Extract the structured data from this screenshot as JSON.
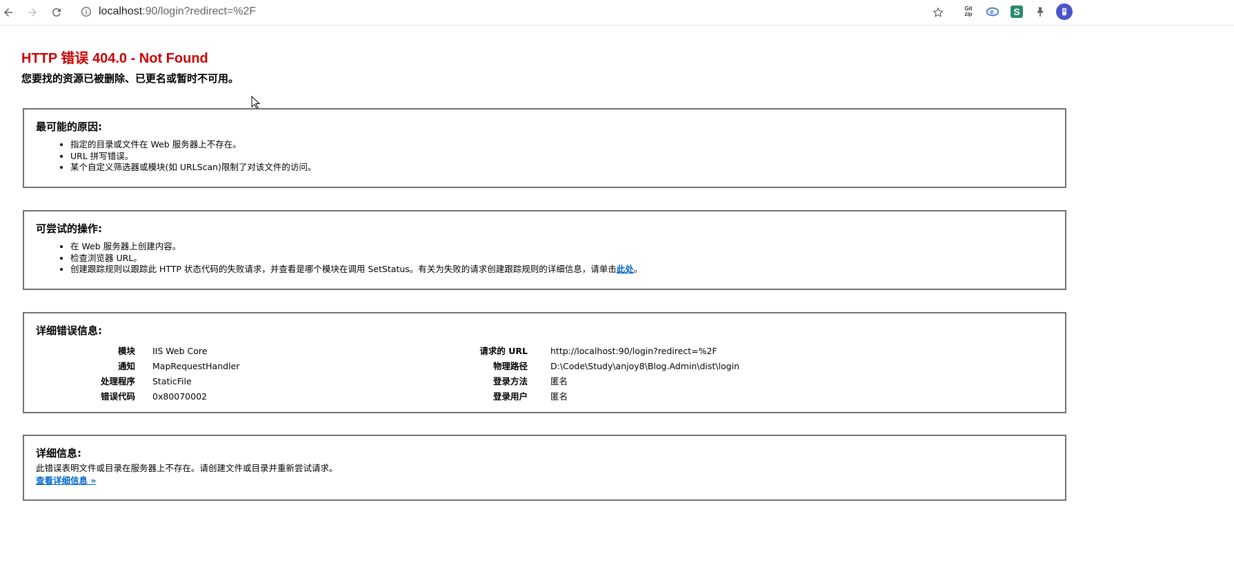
{
  "browser": {
    "url_host": "localhost",
    "url_rest": ":90/login?redirect=%2F",
    "icons": [
      "back-arrow-icon",
      "forward-arrow-icon",
      "reload-icon",
      "info-icon",
      "bookmark-star-icon",
      "git-zip-extension-icon",
      "ie-extension-icon",
      "s-extension-icon",
      "pin-extension-icon",
      "avatar-icon"
    ],
    "ext_git_line1": "Git",
    "ext_git_line2": "zip",
    "ext_s": "S"
  },
  "page": {
    "title": "HTTP 错误 404.0 - Not Found",
    "subtitle": "您要找的资源已被删除、已更名或暂时不可用。",
    "title_color": "#cc0000"
  },
  "causes": {
    "heading": "最可能的原因:",
    "items": [
      "指定的目录或文件在 Web 服务器上不存在。",
      "URL 拼写错误。",
      "某个自定义筛选器或模块(如 URLScan)限制了对该文件的访问。"
    ]
  },
  "actions": {
    "heading": "可尝试的操作:",
    "items": [
      "在 Web 服务器上创建内容。",
      "检查浏览器 URL。"
    ],
    "item3_text": "创建跟踪规则以跟踪此 HTTP 状态代码的失败请求，并查看是哪个模块在调用 SetStatus。有关为失败的请求创建跟踪规则的详细信息，请单击",
    "item3_link": "此处",
    "item3_end": "。"
  },
  "details": {
    "heading": "详细错误信息:",
    "left": [
      {
        "label": "模块",
        "value": "IIS Web Core"
      },
      {
        "label": "通知",
        "value": "MapRequestHandler"
      },
      {
        "label": "处理程序",
        "value": "StaticFile"
      },
      {
        "label": "错误代码",
        "value": "0x80070002"
      }
    ],
    "right": [
      {
        "label": "请求的 URL",
        "value": "http://localhost:90/login?redirect=%2F"
      },
      {
        "label": "物理路径",
        "value": "D:\\Code\\Study\\anjoy8\\Blog.Admin\\dist\\login"
      },
      {
        "label": "登录方法",
        "value": "匿名"
      },
      {
        "label": "登录用户",
        "value": "匿名"
      }
    ]
  },
  "more_info": {
    "heading": "详细信息:",
    "text": "此错误表明文件或目录在服务器上不存在。请创建文件或目录并重新尝试请求。",
    "link": "查看详细信息 »"
  }
}
